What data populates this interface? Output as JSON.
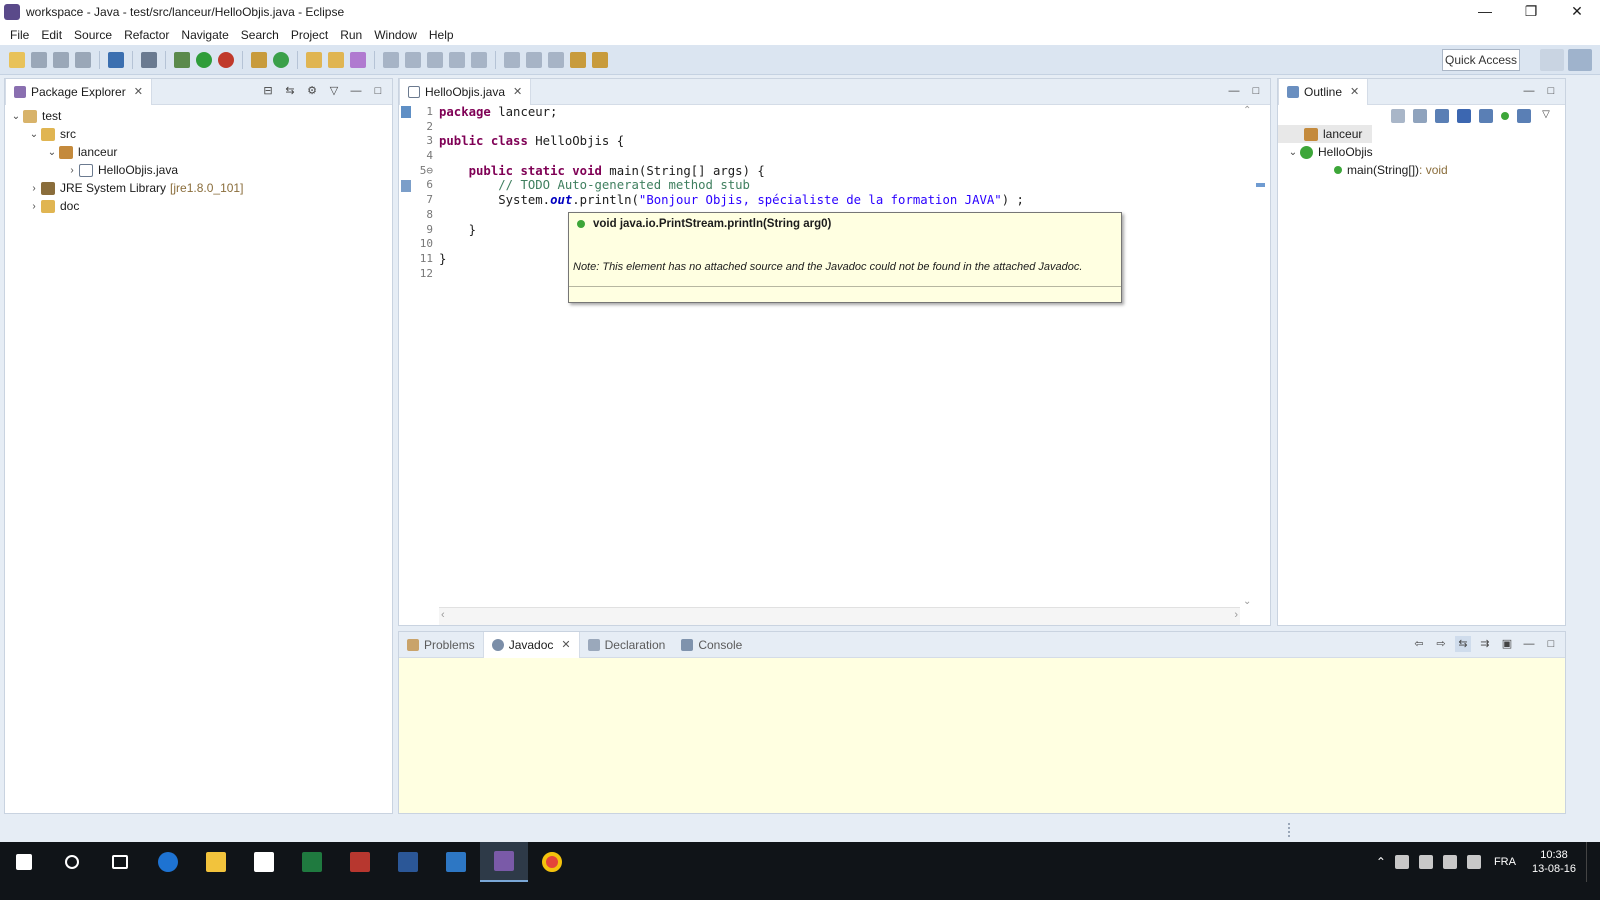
{
  "window": {
    "title": "workspace - Java - test/src/lanceur/HelloObjis.java - Eclipse",
    "controls": [
      "—",
      "❐",
      "✕"
    ]
  },
  "menu": [
    "File",
    "Edit",
    "Source",
    "Refactor",
    "Navigate",
    "Search",
    "Project",
    "Run",
    "Window",
    "Help"
  ],
  "toolbar": {
    "quick_access": "Quick Access"
  },
  "package_explorer": {
    "tab": "Package Explorer",
    "tree": [
      {
        "label": "test",
        "extra": ""
      },
      {
        "label": "src",
        "extra": ""
      },
      {
        "label": "lanceur",
        "extra": ""
      },
      {
        "label": "HelloObjis.java",
        "extra": ""
      },
      {
        "label": "JRE System Library",
        "extra": "[jre1.8.0_101]"
      },
      {
        "label": "doc",
        "extra": ""
      }
    ]
  },
  "editor": {
    "tab": "HelloObjis.java",
    "line_numbers": [
      "1",
      "2",
      "3",
      "4",
      "5⊖",
      "6",
      "7",
      "8",
      "9",
      "10",
      "11",
      "12"
    ],
    "code": {
      "l1_kw": "package",
      "l1_rest": " lanceur;",
      "l3_kw1": "public",
      "l3_kw2": "class",
      "l3_rest": " HelloObjis {",
      "l5_kw1": "public",
      "l5_kw2": "static",
      "l5_kw3": "void",
      "l5_rest": " main(String[] args) {",
      "l6_comment": "// TODO Auto-generated method stub",
      "l7_a": "System.",
      "l7_field": "out",
      "l7_b": ".println(",
      "l7_str": "\"Bonjour Objis, spécialiste de la formation JAVA\"",
      "l7_c": ") ;",
      "l9": "}",
      "l11": "}"
    }
  },
  "tooltip": {
    "signature": "void java.io.PrintStream.println(String arg0)",
    "note": "Note: This element has no attached source and the Javadoc could not be found in the attached Javadoc."
  },
  "outline": {
    "tab": "Outline",
    "package": "lanceur",
    "class": "HelloObjis",
    "method": "main(String[])",
    "method_type": " : void"
  },
  "bottom_tabs": {
    "problems": "Problems",
    "javadoc": "Javadoc",
    "declaration": "Declaration",
    "console": "Console"
  },
  "taskbar": {
    "time": "10:38",
    "date": "13-08-16",
    "lang": "FRA"
  },
  "colors": {
    "keyword": "#7f0055",
    "comment": "#3f7f5f",
    "string": "#2a00ff",
    "tooltip_bg": "#ffffe1"
  }
}
